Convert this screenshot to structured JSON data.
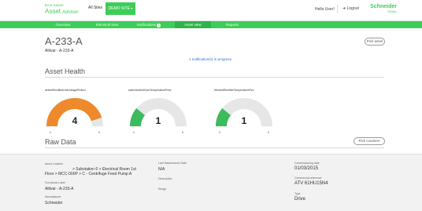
{
  "brand": {
    "top": "Ecoτ ruxure",
    "main": "Asset",
    "sub": "Advisor"
  },
  "sites": {
    "all_label": "All Sites",
    "current_site": "DEMO SITE"
  },
  "user": {
    "hello": "Hello User!",
    "logout": "Logout"
  },
  "company": {
    "name": "Schneider",
    "sub": "Electric"
  },
  "nav": {
    "tabs": [
      {
        "label": "Overview"
      },
      {
        "label": "Electrical view"
      },
      {
        "label": "Notifications"
      },
      {
        "label": "Asset view"
      },
      {
        "label": "Reports"
      }
    ],
    "notifications_badge": "1"
  },
  "asset": {
    "title": "A-233-A",
    "subtitle": "Altivar - A-233-A",
    "pick_asset_label": "Pick asset",
    "notifications_link": "1 notification(s) in progress"
  },
  "asset_health": {
    "title": "Asset Health",
    "gauges": [
      {
        "label": "detectRectifiedUnitVoltagePicked",
        "value": "4",
        "fill": 0.9,
        "color": "#ee8a2b",
        "min": "0",
        "max": "5"
      },
      {
        "label": "switchedUnitOverTemperaturePred",
        "value": "1",
        "fill": 0.22,
        "color": "#3dba5c",
        "min": "0",
        "max": "5"
      },
      {
        "label": "WindedRectifierTemperatureRec",
        "value": "1",
        "fill": 0.22,
        "color": "#3dba5c",
        "min": "0",
        "max": "5"
      }
    ]
  },
  "raw_data": {
    "title": "Raw Data",
    "pick_counters_label": "Pick counters"
  },
  "details": {
    "asset_location_label": "Asset Location",
    "asset_location_line1": "> Substation 6 > Electrical Room 1st",
    "asset_location_line2": "Floor > MCC-000P > C - Centrifuge Feed Pump A",
    "functional_label_label": "Functional Label",
    "functional_label_value": "Altivar - A-233-A",
    "manufacturer_label": "Manufacturer",
    "manufacturer_value": "Schneider",
    "last_maintenance_label": "Last Maintenance Date",
    "last_maintenance_value": "N/A",
    "description_label": "Description",
    "range_label": "Range",
    "commissioning_label": "Commissioning date",
    "commissioning_value": "01/03/2015",
    "commercial_ref_label": "Commercial reference",
    "commercial_ref_value": "ATV 61HU15N4",
    "type_label": "Type",
    "type_value": "Drive"
  }
}
